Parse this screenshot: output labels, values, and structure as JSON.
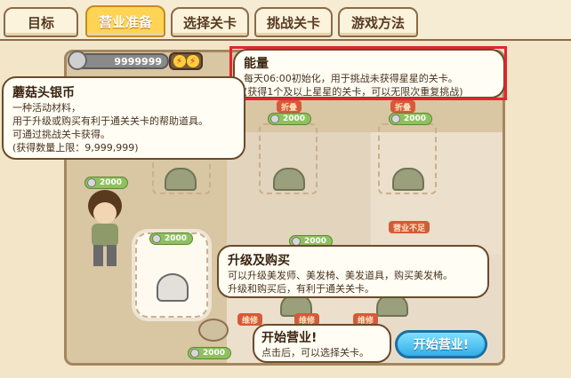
{
  "tabs": [
    {
      "label": "目标",
      "active": false
    },
    {
      "label": "营业准备",
      "active": true
    },
    {
      "label": "选择关卡",
      "active": false
    },
    {
      "label": "挑战关卡",
      "active": false
    },
    {
      "label": "游戏方法",
      "active": false
    }
  ],
  "header": {
    "coin_value": "9999999",
    "energy_icons": [
      "lightning-icon",
      "lightning-icon"
    ]
  },
  "bubbles": {
    "energy": {
      "title": "能量",
      "lines": [
        "每天06:00初始化，用于挑战未获得星星的关卡。",
        "(获得1个及以上星星的关卡，可以无限次重复挑战)"
      ]
    },
    "coin": {
      "title": "蘑菇头银币",
      "lines": [
        "一种活动材料，",
        "用于升级或购买有利于通关关卡的帮助道具。",
        "可通过挑战关卡获得。",
        "(获得数量上限：9,999,999)"
      ]
    },
    "upgrade": {
      "title": "升级及购买",
      "lines": [
        "可以升级美发师、美发椅、美发道具，购买美发椅。",
        "升级和购买后，有利于通关关卡。"
      ]
    },
    "start": {
      "title": "开始营业!",
      "lines": [
        "点击后，可以选择关卡。"
      ]
    }
  },
  "shop": {
    "price_tags": [
      "2000",
      "2000",
      "2000",
      "2000",
      "2000"
    ],
    "red_tags": [
      "折叠",
      "折叠",
      "营业不足",
      "维修",
      "维修",
      "维修"
    ],
    "highlight_price": "2000"
  },
  "start_button": {
    "label": "开始营业!"
  },
  "colors": {
    "tab_active": "#ffd454",
    "highlight_box": "#e3252f",
    "start_button": "#33aee6"
  }
}
